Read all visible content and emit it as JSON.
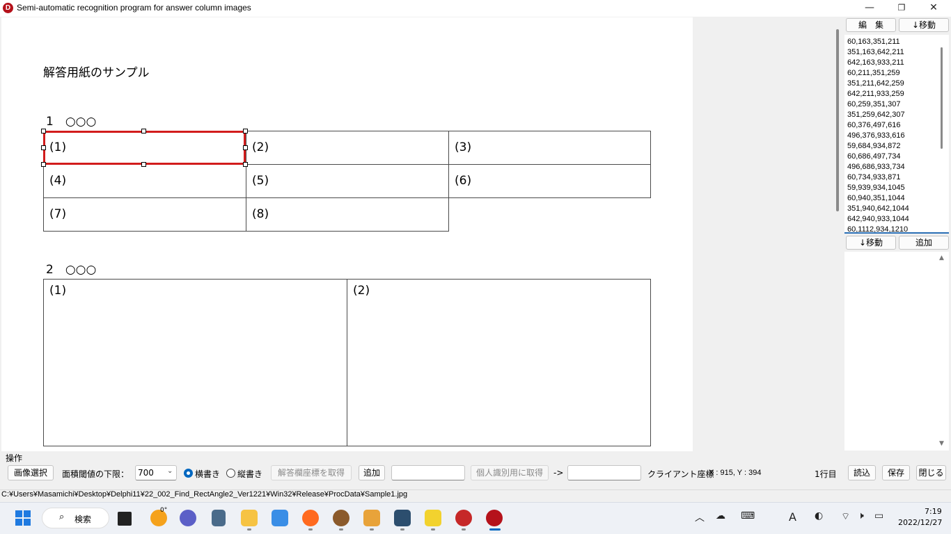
{
  "window": {
    "title": "Semi-automatic recognition program for answer column images",
    "app_icon_letter": "D",
    "minimize": "—",
    "restore": "❐",
    "close": "✕"
  },
  "document": {
    "heading": "解答用紙のサンプル",
    "section1": "1　○○○",
    "section2": "2　○○○",
    "cells1": [
      "(1)",
      "(2)",
      "(3)",
      "(4)",
      "(5)",
      "(6)",
      "(7)",
      "(8)"
    ],
    "cells2": [
      "(1)",
      "(2)"
    ]
  },
  "right_panel": {
    "edit_button": "編　集",
    "move_down_button": "↓移動",
    "coordinates": [
      "60,163,351,211",
      "351,163,642,211",
      "642,163,933,211",
      "60,211,351,259",
      "351,211,642,259",
      "642,211,933,259",
      "60,259,351,307",
      "351,259,642,307",
      "60,376,497,616",
      "496,376,933,616",
      "59,684,934,872",
      "60,686,497,734",
      "496,686,933,734",
      "60,734,933,871",
      "59,939,934,1045",
      "60,940,351,1044",
      "351,940,642,1044",
      "642,940,933,1044",
      "60,1112,934,1210"
    ],
    "move_down_button2": "↓移動",
    "add_button": "追加"
  },
  "controls": {
    "group_label": "操作",
    "select_image": "画像選択",
    "area_threshold_label": "面積閾値の下限：",
    "area_threshold_value": "700",
    "radio_horizontal": "横書き",
    "radio_vertical": "縦書き",
    "get_answer_coords": "解答欄座標を取得",
    "add": "追加",
    "get_personal_id": "個人識別用に取得",
    "arrow": "->",
    "client_coords_label": "クライアント座標",
    "client_coords_value": "X : 915, Y : 394",
    "row_indicator": "1行目",
    "load": "読込",
    "save": "保存",
    "close": "閉じる"
  },
  "status": {
    "path": "C:¥Users¥Masamichi¥Desktop¥Delphi11¥22_002_Find_RectAngle2_Ver1221¥Win32¥Release¥ProcData¥Sample1.jpg"
  },
  "taskbar": {
    "search_label": "検索",
    "weather_temp": "0°",
    "time": "7:19",
    "date": "2022/12/27",
    "ime_label": "A"
  }
}
